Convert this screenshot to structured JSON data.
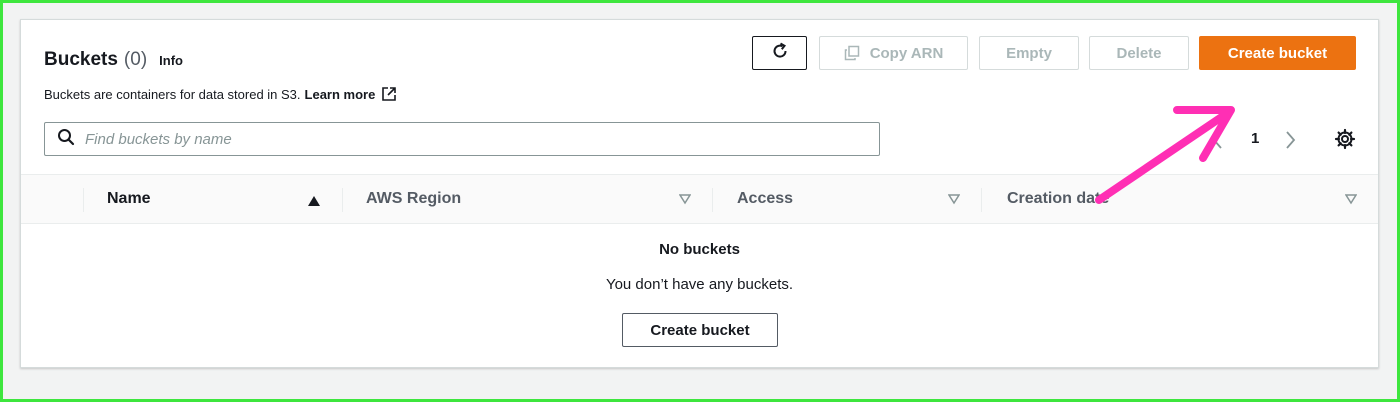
{
  "header": {
    "title": "Buckets",
    "count": "(0)",
    "info": "Info",
    "description": "Buckets are containers for data stored in S3.",
    "learn_more": "Learn more"
  },
  "actions": {
    "copy_arn": "Copy ARN",
    "empty": "Empty",
    "delete": "Delete",
    "create_bucket": "Create bucket"
  },
  "search": {
    "placeholder": "Find buckets by name",
    "value": ""
  },
  "pagination": {
    "current_page": "1"
  },
  "table": {
    "columns": [
      {
        "label": "Name",
        "sort": "ascending"
      },
      {
        "label": "AWS Region",
        "sort": "none"
      },
      {
        "label": "Access",
        "sort": "none"
      },
      {
        "label": "Creation date",
        "sort": "none"
      }
    ],
    "empty_title": "No buckets",
    "empty_message": "You don’t have any buckets.",
    "empty_action": "Create bucket"
  },
  "colors": {
    "primary": "#ec7211",
    "annotation_arrow": "#ff2fb4",
    "frame": "#3ee63e"
  },
  "icons": [
    "refresh-icon",
    "copy-icon",
    "external-link-icon",
    "search-icon",
    "chevron-left-icon",
    "chevron-right-icon",
    "gear-icon",
    "sort-ascending-icon",
    "sort-icon",
    "annotation-arrow"
  ]
}
